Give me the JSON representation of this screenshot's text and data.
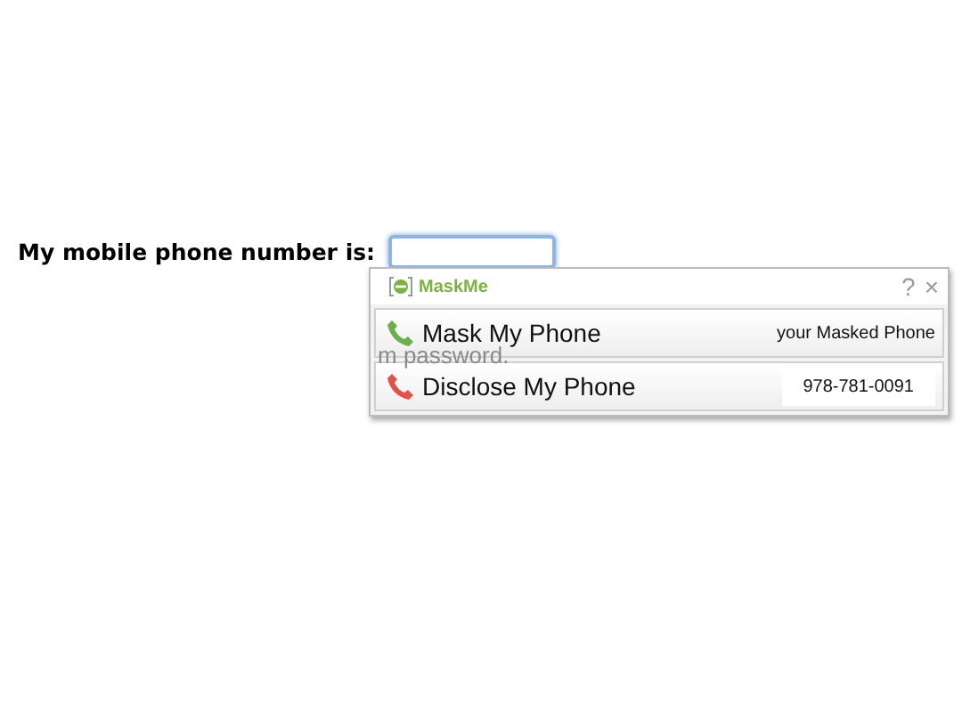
{
  "field": {
    "label": "My mobile phone number is:",
    "focused": true
  },
  "background_text": "m password.",
  "popup": {
    "brand": "MaskMe",
    "help": "?",
    "close": "×",
    "rows": [
      {
        "kind": "mask",
        "label": "Mask My Phone",
        "detail": "your Masked Phone",
        "boxed": false
      },
      {
        "kind": "disclose",
        "label": "Disclose My Phone",
        "detail": "978-781-0091",
        "boxed": true
      }
    ]
  }
}
